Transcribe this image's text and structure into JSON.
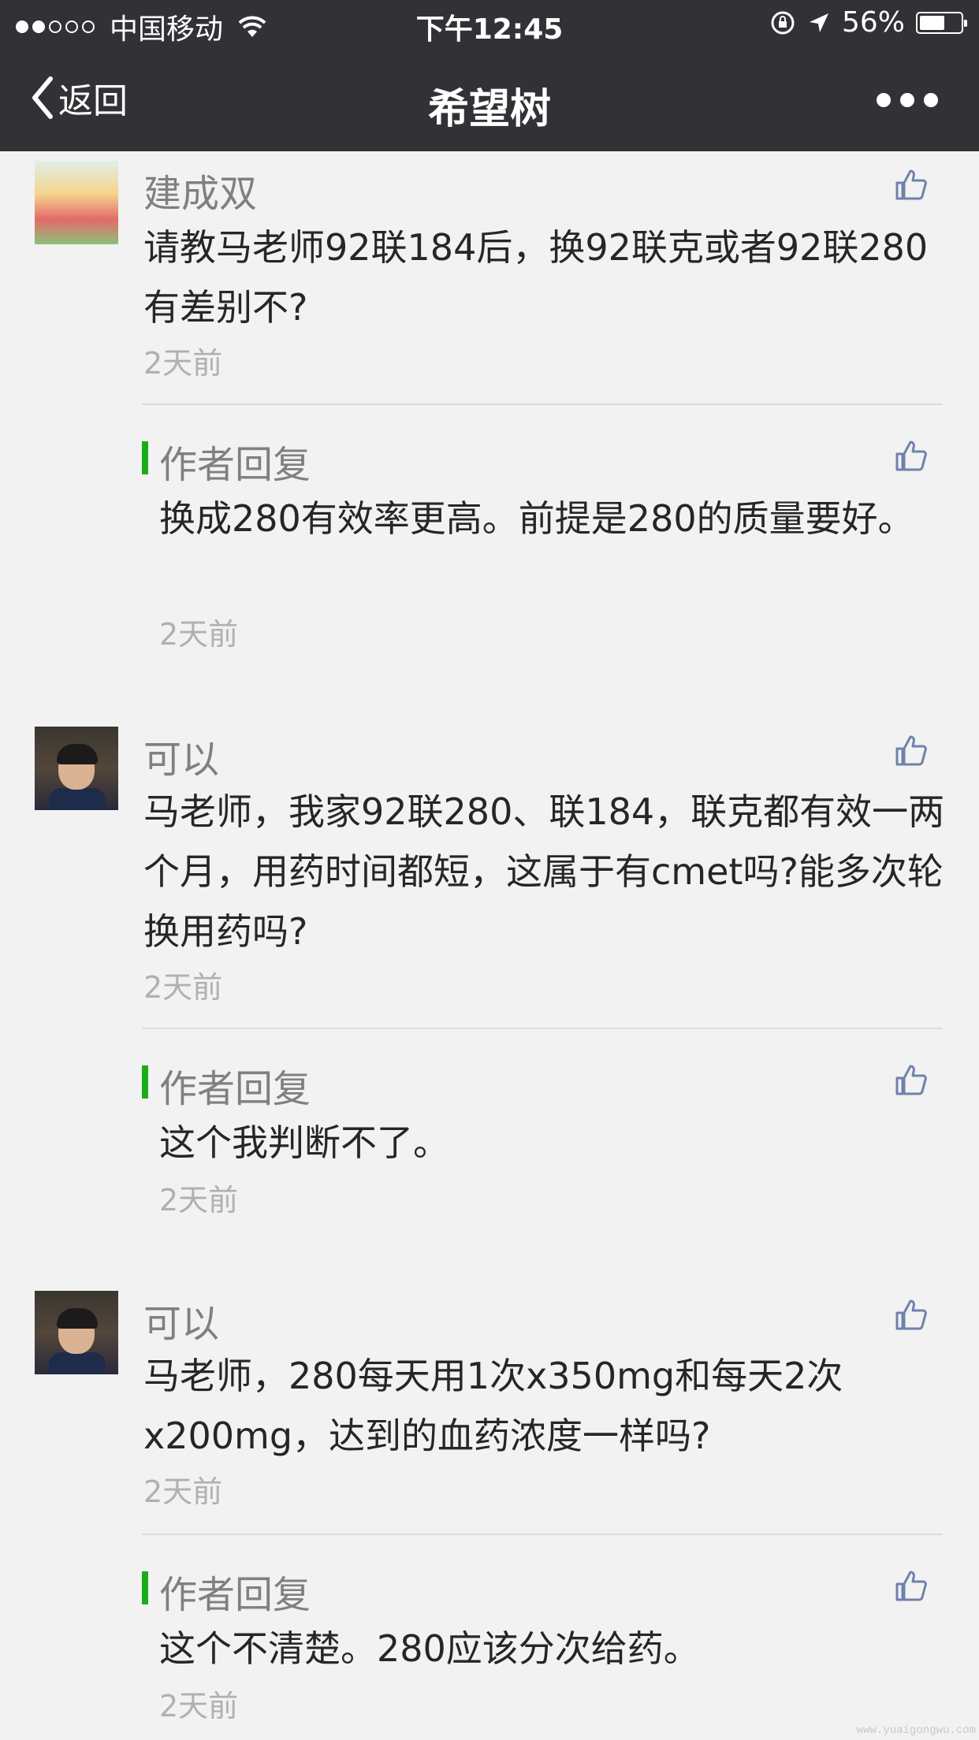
{
  "status_bar": {
    "carrier": "中国移动",
    "time": "下午12:45",
    "battery": "56%",
    "battery_level": 0.56
  },
  "nav": {
    "back_label": "返回",
    "title": "希望树"
  },
  "comments": [
    {
      "author": "建成双",
      "text": "请教马老师92联184后，换92联克或者92联280有差别不?",
      "time": "2天前",
      "reply": {
        "label": "作者回复",
        "text": "换成280有效率更高。前提是280的质量要好。",
        "time": "2天前"
      }
    },
    {
      "author": "可以",
      "text": "马老师，我家92联280、联184，联克都有效一两个月，用药时间都短，这属于有cmet吗?能多次轮换用药吗?",
      "time": "2天前",
      "reply": {
        "label": "作者回复",
        "text": "这个我判断不了。",
        "time": "2天前"
      }
    },
    {
      "author": "可以",
      "text": "马老师，280每天用1次x350mg和每天2次x200mg，达到的血药浓度一样吗?",
      "time": "2天前",
      "reply": {
        "label": "作者回复",
        "text": "这个不清楚。280应该分次给药。",
        "time": "2天前"
      }
    }
  ],
  "watermark": "www.yuaigongwu.com"
}
